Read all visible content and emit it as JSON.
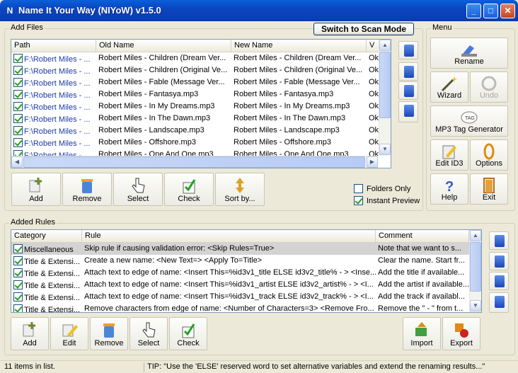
{
  "window": {
    "title": "Name It Your Way (NIYoW) v1.5.0"
  },
  "add_files": {
    "group_label": "Add Files",
    "scan_button": "Switch to Scan Mode",
    "columns": [
      "Path",
      "Old Name",
      "New Name",
      "V"
    ],
    "rows": [
      {
        "path": "F:\\Robert Miles - ...",
        "old": "Robert Miles - Children (Dream Ver...",
        "new": "Robert Miles - Children (Dream Ver...",
        "v": "Ok"
      },
      {
        "path": "F:\\Robert Miles - ...",
        "old": "Robert Miles - Children (Original Ve...",
        "new": "Robert Miles - Children (Original Ve...",
        "v": "Ok"
      },
      {
        "path": "F:\\Robert Miles - ...",
        "old": "Robert Miles - Fable (Message Ver...",
        "new": "Robert Miles - Fable (Message Ver...",
        "v": "Ok"
      },
      {
        "path": "F:\\Robert Miles - ...",
        "old": "Robert Miles - Fantasya.mp3",
        "new": "Robert Miles - Fantasya.mp3",
        "v": "Ok"
      },
      {
        "path": "F:\\Robert Miles - ...",
        "old": "Robert Miles - In My Dreams.mp3",
        "new": "Robert Miles - In My Dreams.mp3",
        "v": "Ok"
      },
      {
        "path": "F:\\Robert Miles - ...",
        "old": "Robert Miles - In The Dawn.mp3",
        "new": "Robert Miles - In The Dawn.mp3",
        "v": "Ok"
      },
      {
        "path": "F:\\Robert Miles - ...",
        "old": "Robert Miles - Landscape.mp3",
        "new": "Robert Miles - Landscape.mp3",
        "v": "Ok"
      },
      {
        "path": "F:\\Robert Miles - ...",
        "old": "Robert Miles - Offshore.mp3",
        "new": "Robert Miles - Offshore.mp3",
        "v": "Ok"
      },
      {
        "path": "F:\\Robert Miles - ...",
        "old": "Robert Miles - One And One.mp3",
        "new": "Robert Miles - One And One.mp3",
        "v": "Ok"
      }
    ],
    "toolbar": {
      "add": "Add",
      "remove": "Remove",
      "select": "Select",
      "check": "Check",
      "sort": "Sort by..."
    },
    "folders_only": "Folders Only",
    "instant_preview": "Instant Preview"
  },
  "menu": {
    "group_label": "Menu",
    "rename": "Rename",
    "wizard": "Wizard",
    "undo": "Undo",
    "mp3tag": "MP3 Tag Generator",
    "editid3": "Edit ID3",
    "options": "Options",
    "help": "Help",
    "exit": "Exit"
  },
  "added_rules": {
    "group_label": "Added Rules",
    "columns": [
      "Category",
      "Rule",
      "Comment"
    ],
    "rows": [
      {
        "cat": "Miscellaneous",
        "rule": "Skip rule if causing validation error: <Skip Rules=True>",
        "comment": "Note that we want to s..."
      },
      {
        "cat": "Title & Extensi...",
        "rule": "Create a new name: <New Text=> <Apply To=Title>",
        "comment": "Clear the name. Start fr..."
      },
      {
        "cat": "Title & Extensi...",
        "rule": "Attach text to edge of name: <Insert This=%id3v1_title ELSE id3v2_title% - > <Inse...",
        "comment": "Add the title if available..."
      },
      {
        "cat": "Title & Extensi...",
        "rule": "Attach text to edge of name: <Insert This=%id3v1_artist ELSE id3v2_artist% - > <I...",
        "comment": "Add the artist if available..."
      },
      {
        "cat": "Title & Extensi...",
        "rule": "Attach text to edge of name: <Insert This=%id3v1_track ELSE id3v2_track% - > <I...",
        "comment": "Add the track if availabl..."
      },
      {
        "cat": "Title & Extensi...",
        "rule": "Remove characters from edge of name: <Number of Characters=3> <Remove Fro...",
        "comment": "Remove the \" - \" from t..."
      }
    ],
    "toolbar": {
      "add": "Add",
      "edit": "Edit",
      "remove": "Remove",
      "select": "Select",
      "check": "Check",
      "import": "Import",
      "export": "Export"
    }
  },
  "status": {
    "count": "11 items in list.",
    "tip": "TIP: \"Use the 'ELSE' reserved word to set alternative variables and extend the renaming results...\""
  }
}
